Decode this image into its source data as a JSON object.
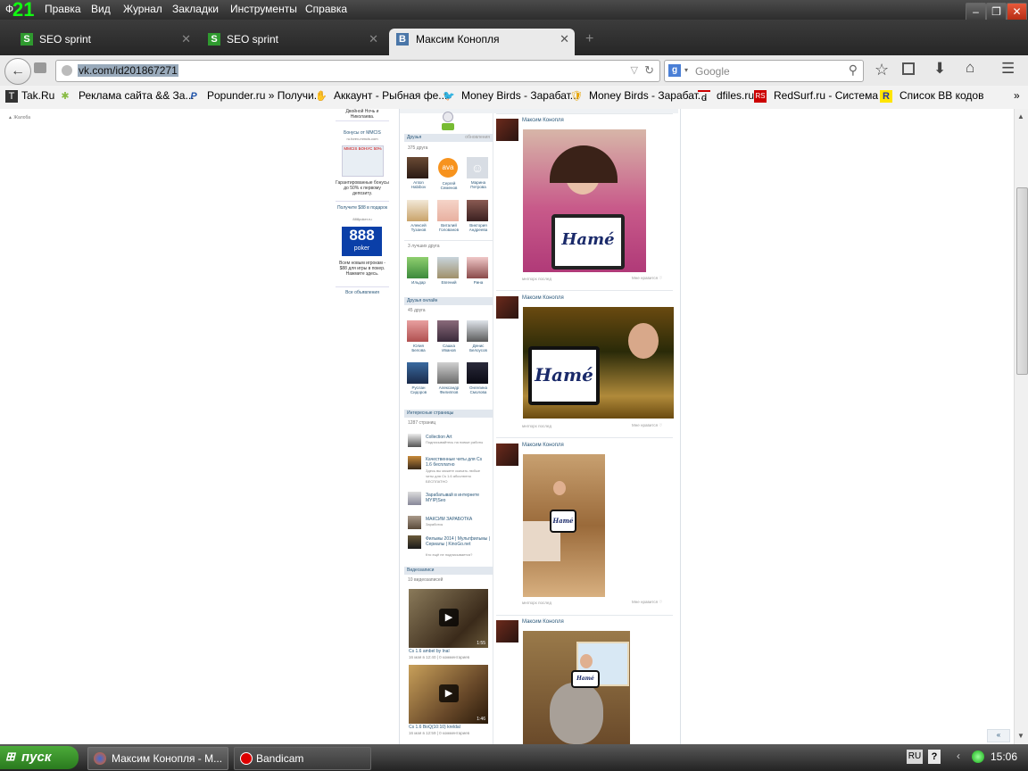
{
  "menubar": {
    "counter": "21",
    "file_short": "Ф",
    "items": [
      "Правка",
      "Вид",
      "Журнал",
      "Закладки",
      "Инструменты",
      "Справка"
    ]
  },
  "tabs": [
    {
      "label": "SEO sprint",
      "fav": "S"
    },
    {
      "label": "SEO sprint",
      "fav": "S"
    },
    {
      "label": "Максим Конопля",
      "fav": "B"
    }
  ],
  "nav": {
    "url": "vk.com/id201867271",
    "search_engine_icon": "google-g",
    "search_placeholder": "Google"
  },
  "bookmarks": [
    {
      "label": "Tak.Ru",
      "icon": "T"
    },
    {
      "label": "Реклама сайта && За...",
      "icon": "✱"
    },
    {
      "label": "Popunder.ru » Получи...",
      "icon": "P"
    },
    {
      "label": "Аккаунт - Рыбная фе...",
      "icon": "✋"
    },
    {
      "label": "Money Birds - Зарабат...",
      "icon": "🐦"
    },
    {
      "label": "Money Birds - Зарабат...",
      "icon": "🛡"
    },
    {
      "label": "dfiles.ru",
      "icon": "d"
    },
    {
      "label": "RedSurf.ru - Система ...",
      "icon": "RS"
    },
    {
      "label": "Список ВВ кодов",
      "icon": "R"
    }
  ],
  "left_note": "Жалоба",
  "ads": {
    "top": "Двойной Ночь и Николаева.",
    "block1_title": "Бонусы от MMCIS",
    "block1_site": "ru.forex-mmcis.com",
    "block1_caption": "Гарантированные бонусы до 50% к первому депозиту.",
    "block1_img": "MMCIS БОНУС 50%",
    "block2_title": "Получите $88 в подарок",
    "block2_site": "888poker.ru",
    "block2_caption": "Всем новым игрокам - $88 для игры в покер. Нажмите здесь.",
    "block2_img1": "888",
    "block2_img2": "poker",
    "all_ads": "Все объявления"
  },
  "friends": {
    "title": "Друзья",
    "updates": "обновления",
    "count": "375 друга",
    "list": [
      "Anton Habibov",
      "Сергей Семенов",
      "Марина Петрова",
      "Алексей Тузанов",
      "Виталий Голованов",
      "Виктория Андреева"
    ],
    "online_count": "3 лучших друга",
    "online_list": [
      "Ильдар",
      "Евгений",
      "Рина"
    ]
  },
  "friends_online": {
    "title": "Друзья онлайн",
    "count": "45 друга",
    "list": [
      "Юлия Белова",
      "Сашка Иванов",
      "Денис Белоусов",
      "Руслан Сидоров",
      "Александр Филиппов",
      "Онгелина Смолова"
    ]
  },
  "pages": {
    "title": "Интересные страницы",
    "count": "1287 страниц",
    "list": [
      {
        "name": "Collection Art",
        "desc": "Подписывайтесь на новые работы"
      },
      {
        "name": "Качественные читы для Cs 1.6 бесплатно",
        "desc": "Здесь вы можете скачать любые читы для Cs 1.6 абсолютно БЕСПЛАТНО"
      },
      {
        "name": "Зарабатывай в интернете MYIP|Seo",
        "desc": ""
      },
      {
        "name": "МАКСИМ ЗАРАБОТКА",
        "desc": "Заработок"
      },
      {
        "name": "Фильмы 2014 | Мультфильмы | Сериалы | KinoGo.net",
        "desc": "Кто ещё не подписывается?"
      }
    ]
  },
  "videos": {
    "title": "Видеозаписи",
    "count": "10 видеозаписей",
    "list": [
      {
        "title": "Cs 1.6 ambel by Inal",
        "meta": "16 мая в 12:40 | 0 комментариев",
        "duration": "1:55"
      },
      {
        "title": "Cs 1.6 BoQ(10:10) kreldal",
        "meta": "16 мая в 12:59 | 0 комментариев",
        "duration": "1:46"
      }
    ]
  },
  "posts": [
    {
      "author": "Максим Конопля",
      "meta": "мнгпорх послед",
      "like": "Мне нравится",
      "brand": "Hamé"
    },
    {
      "author": "Максим Конопля",
      "meta": "мнгпорх послед",
      "like": "Мне нравится",
      "brand": "Hamé"
    },
    {
      "author": "Максим Конопля",
      "meta": "мнгпорх послед",
      "like": "Мне нравится",
      "brand": "Hamé"
    },
    {
      "author": "Максим Конопля",
      "meta": "",
      "like": "",
      "brand": "Hamé"
    }
  ],
  "taskbar": {
    "start": "пуск",
    "items": [
      "Максим Конопля - М...",
      "Bandicam"
    ],
    "lang": "RU",
    "help": "?",
    "time": "15:06",
    "scroll_hint": "«"
  }
}
